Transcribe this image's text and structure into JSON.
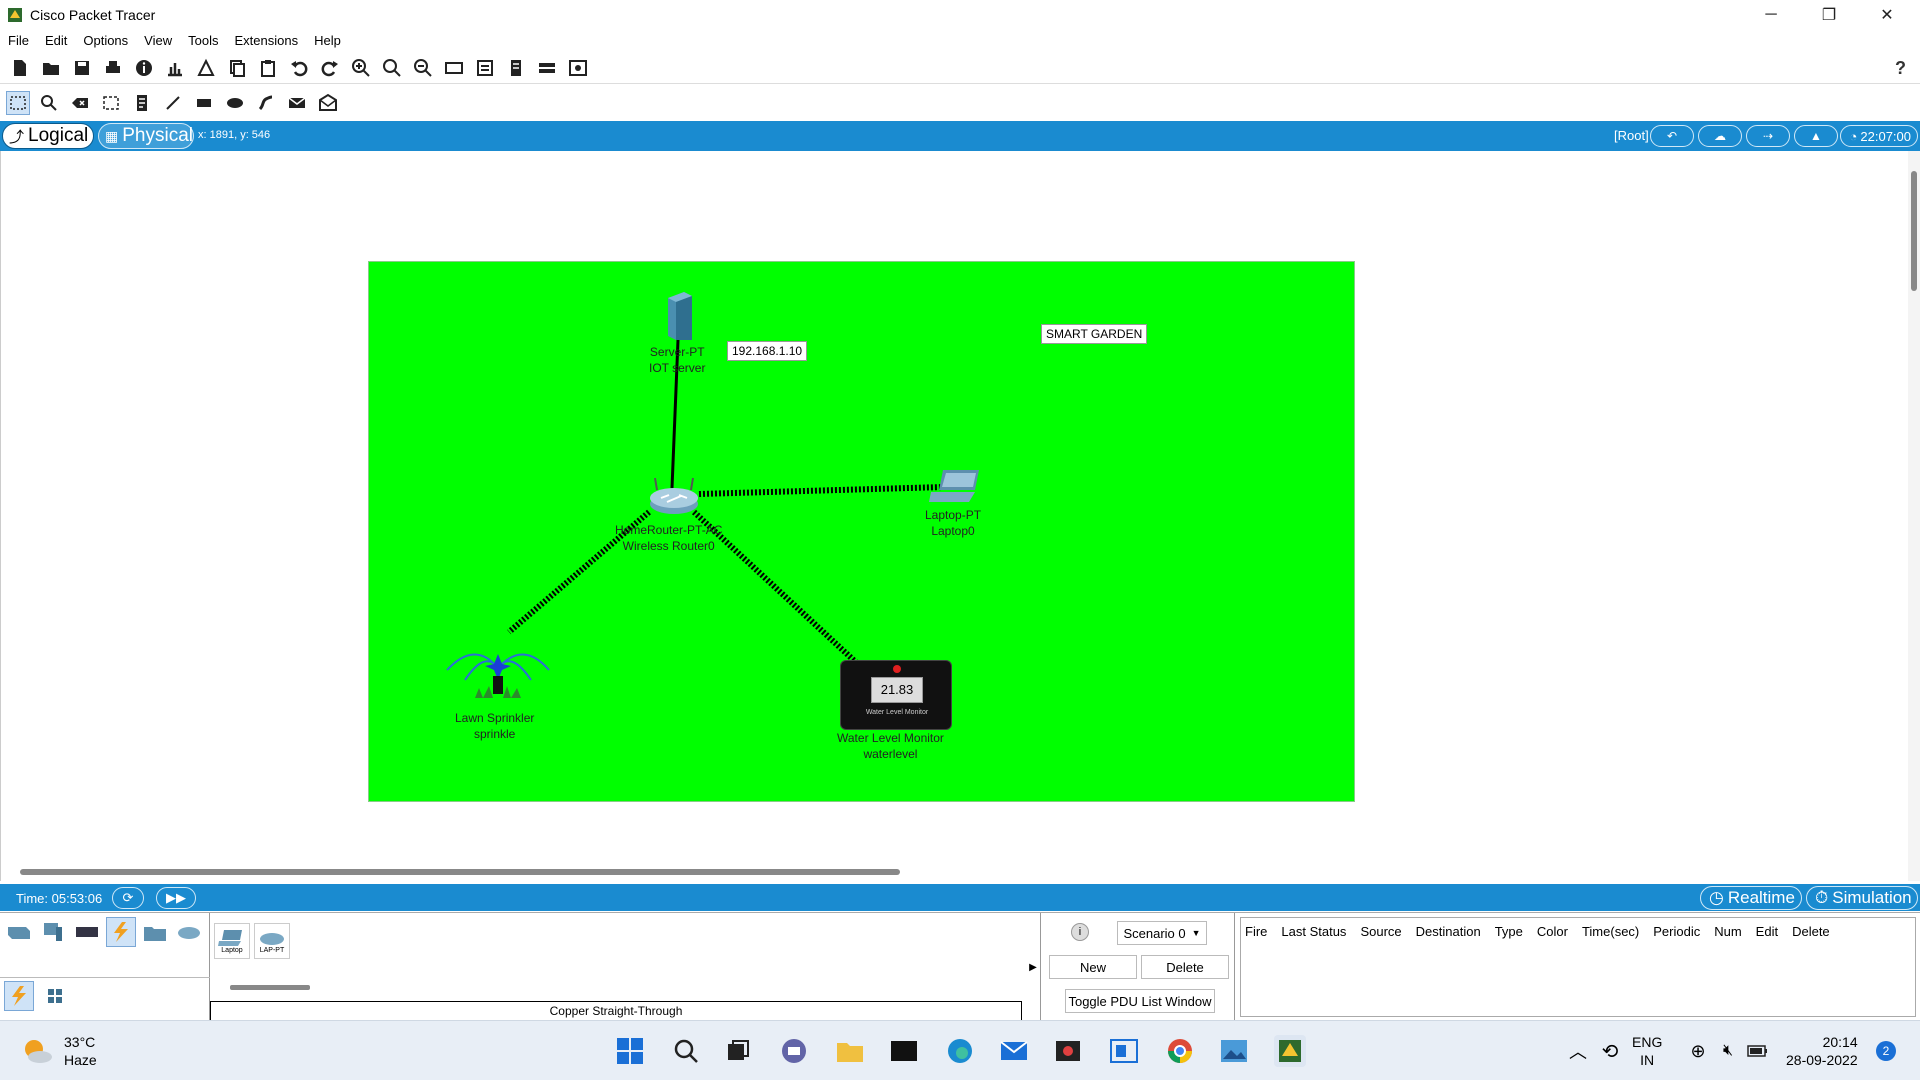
{
  "window": {
    "title": "Cisco Packet Tracer",
    "minimize": "─",
    "restore": "❐",
    "close": "✕"
  },
  "menu": {
    "items": [
      "File",
      "Edit",
      "Options",
      "View",
      "Tools",
      "Extensions",
      "Help"
    ]
  },
  "toolbar": {
    "help": "?"
  },
  "modebar": {
    "logical": "Logical",
    "physical": "Physical",
    "coord": "x: 1891, y: 546",
    "root": "[Root]",
    "clock": "22:07:00"
  },
  "canvas": {
    "note_ip": "192.168.1.10",
    "note_title": "SMART GARDEN",
    "devices": {
      "server": {
        "model": "Server-PT",
        "name": "IOT server"
      },
      "router": {
        "model": "HomeRouter-PT-AC",
        "name": "Wireless Router0"
      },
      "laptop": {
        "model": "Laptop-PT",
        "name": "Laptop0"
      },
      "sprinkler": {
        "model": "Lawn Sprinkler",
        "name": "sprinkle"
      },
      "water": {
        "model": "Water Level Monitor",
        "name": "waterlevel",
        "reading": "21.83",
        "caption": "Water Level Monitor"
      }
    }
  },
  "statusbar": {
    "time": "Time: 05:53:06",
    "realtime": "Realtime",
    "simulation": "Simulation"
  },
  "devices_panel": {
    "items": [
      "Laptop",
      "LAP-PT"
    ],
    "connection": "Copper Straight-Through"
  },
  "scenario": {
    "select": "Scenario 0",
    "new": "New",
    "delete": "Delete",
    "toggle": "Toggle PDU List Window",
    "columns": [
      "Fire",
      "Last Status",
      "Source",
      "Destination",
      "Type",
      "Color",
      "Time(sec)",
      "Periodic",
      "Num",
      "Edit",
      "Delete"
    ]
  },
  "taskbar": {
    "temp": "33°C",
    "weather": "Haze",
    "lang1": "ENG",
    "lang2": "IN",
    "time": "20:14",
    "date": "28-09-2022",
    "notif": "2"
  }
}
